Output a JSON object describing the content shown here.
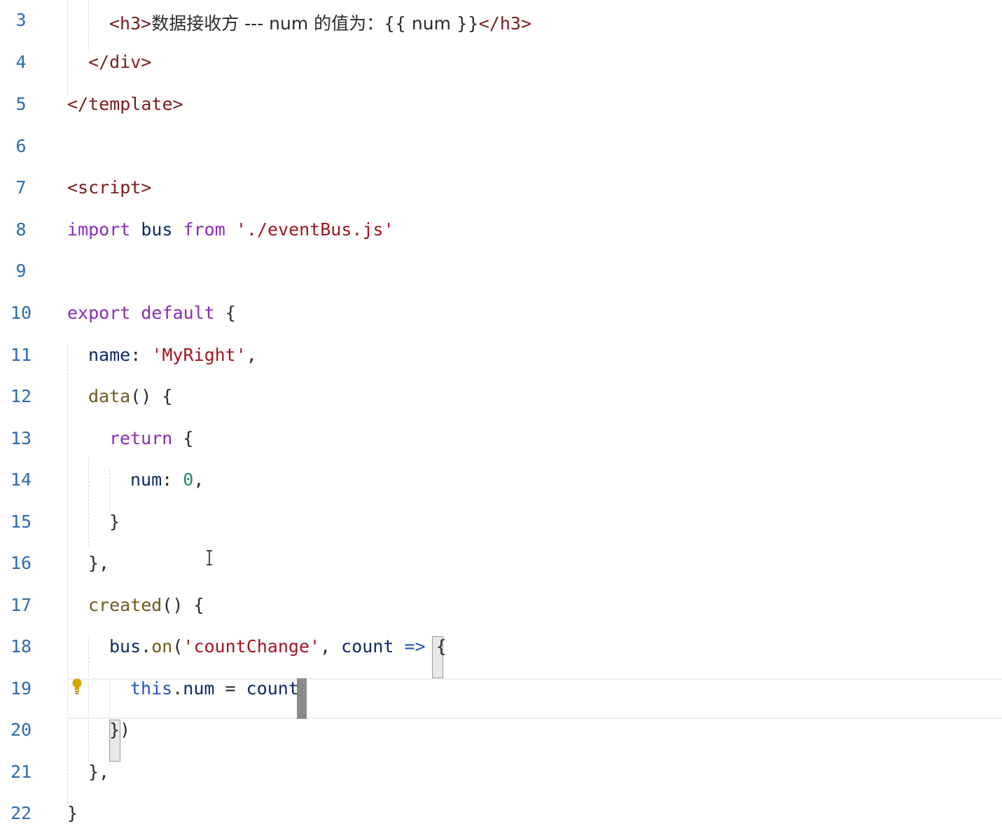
{
  "editor": {
    "lines": [
      {
        "number": "3",
        "tokens": [
          {
            "text": "<h3>",
            "kind": "tag"
          },
          {
            "text": "数据接收方 --- num 的值为：{{ num }}",
            "kind": "text"
          },
          {
            "text": "</h3>",
            "kind": "tag"
          }
        ]
      },
      {
        "number": "4",
        "tokens": [
          {
            "text": "</div>",
            "kind": "tag"
          }
        ]
      },
      {
        "number": "5",
        "tokens": [
          {
            "text": "</template>",
            "kind": "tag"
          }
        ]
      },
      {
        "number": "6",
        "tokens": []
      },
      {
        "number": "7",
        "tokens": [
          {
            "text": "<script>",
            "kind": "tag"
          }
        ]
      },
      {
        "number": "8",
        "tokens": [
          {
            "text": "import",
            "kind": "keyword"
          },
          {
            "text": " bus ",
            "kind": "ident"
          },
          {
            "text": "from",
            "kind": "keyword"
          },
          {
            "text": " './eventBus.js'",
            "kind": "string"
          }
        ]
      },
      {
        "number": "9",
        "tokens": []
      },
      {
        "number": "10",
        "tokens": [
          {
            "text": "export",
            "kind": "keyword"
          },
          {
            "text": " ",
            "kind": "punct"
          },
          {
            "text": "default",
            "kind": "keyword"
          },
          {
            "text": " {",
            "kind": "punct"
          }
        ]
      },
      {
        "number": "11",
        "tokens": [
          {
            "text": "name",
            "kind": "ident"
          },
          {
            "text": ": ",
            "kind": "punct"
          },
          {
            "text": "'MyRight'",
            "kind": "string"
          },
          {
            "text": ",",
            "kind": "punct"
          }
        ]
      },
      {
        "number": "12",
        "tokens": [
          {
            "text": "data",
            "kind": "func"
          },
          {
            "text": "() {",
            "kind": "punct"
          }
        ]
      },
      {
        "number": "13",
        "tokens": [
          {
            "text": "return",
            "kind": "keyword"
          },
          {
            "text": " {",
            "kind": "punct"
          }
        ]
      },
      {
        "number": "14",
        "tokens": [
          {
            "text": "num",
            "kind": "ident"
          },
          {
            "text": ": ",
            "kind": "punct"
          },
          {
            "text": "0",
            "kind": "number"
          },
          {
            "text": ",",
            "kind": "punct"
          }
        ]
      },
      {
        "number": "15",
        "tokens": [
          {
            "text": "}",
            "kind": "punct"
          }
        ]
      },
      {
        "number": "16",
        "tokens": [
          {
            "text": "},",
            "kind": "punct"
          }
        ]
      },
      {
        "number": "17",
        "tokens": [
          {
            "text": "created",
            "kind": "func"
          },
          {
            "text": "() {",
            "kind": "punct"
          }
        ]
      },
      {
        "number": "18",
        "tokens": [
          {
            "text": "bus",
            "kind": "ident"
          },
          {
            "text": ".",
            "kind": "punct"
          },
          {
            "text": "on",
            "kind": "func"
          },
          {
            "text": "(",
            "kind": "punct"
          },
          {
            "text": "'countChange'",
            "kind": "string"
          },
          {
            "text": ", ",
            "kind": "punct"
          },
          {
            "text": "count",
            "kind": "ident"
          },
          {
            "text": " ",
            "kind": "punct"
          },
          {
            "text": "=>",
            "kind": "this"
          },
          {
            "text": " {",
            "kind": "punct"
          }
        ]
      },
      {
        "number": "19",
        "tokens": [
          {
            "text": "this",
            "kind": "this"
          },
          {
            "text": ".",
            "kind": "punct"
          },
          {
            "text": "num",
            "kind": "ident"
          },
          {
            "text": " = ",
            "kind": "punct"
          },
          {
            "text": "count",
            "kind": "ident"
          }
        ]
      },
      {
        "number": "20",
        "tokens": [
          {
            "text": "})",
            "kind": "punct"
          }
        ]
      },
      {
        "number": "21",
        "tokens": [
          {
            "text": "},",
            "kind": "punct"
          }
        ]
      },
      {
        "number": "22",
        "tokens": [
          {
            "text": "}",
            "kind": "punct"
          }
        ]
      }
    ]
  },
  "colors": {
    "line_number": "#2b6cb0",
    "tag": "#7a1c1c",
    "keyword": "#8a2bb8",
    "string": "#a3151f",
    "function": "#6d5b1b",
    "number": "#1f8a66",
    "cursor": "#8a8a8a",
    "bulb": "#d9a400"
  },
  "icons": {
    "lightbulb": "lightbulb-icon",
    "text_cursor": "ibeam-cursor-icon"
  }
}
